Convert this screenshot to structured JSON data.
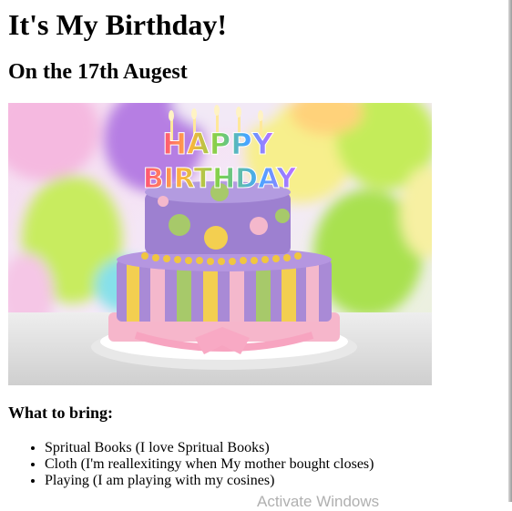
{
  "page": {
    "heading": "It's My Birthday!",
    "subheading": "On the 17th Augest",
    "image": {
      "cake_topper_line1": "HAPPY",
      "cake_topper_line2": "BIRTHDAY"
    },
    "list_heading": "What to bring:",
    "items": [
      "Spritual Books (I love Spritual Books)",
      "Cloth (I'm reallexitingy when My mother bought closes)",
      "Playing (I am playing with my cosines)"
    ]
  },
  "overlay": {
    "watermark_text": "Activate Windows"
  },
  "colors": {
    "background": "#ffffff",
    "text": "#000000",
    "cake_purple": "#a98ad6",
    "cake_yellow": "#f3cf50",
    "cake_pink": "#f4b8cc",
    "cake_green": "#a7c96a"
  }
}
